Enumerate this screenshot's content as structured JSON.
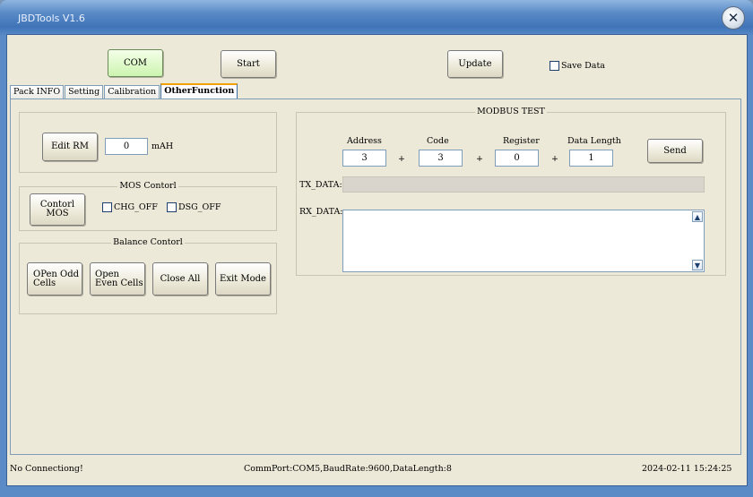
{
  "window": {
    "title": "JBDTools V1.6"
  },
  "toolbar": {
    "com_label": "COM",
    "start_label": "Start",
    "update_label": "Update",
    "save_data_label": "Save Data"
  },
  "tabs": [
    "Pack INFO",
    "Setting",
    "Calibration",
    "OtherFunction"
  ],
  "rm": {
    "button_label": "Edit RM",
    "value": "0",
    "unit": "mAH"
  },
  "mos": {
    "title": "MOS Contorl",
    "button_label": "Contorl MOS",
    "chg_label": "CHG_OFF",
    "dsg_label": "DSG_OFF"
  },
  "balance": {
    "title": "Balance  Contorl",
    "open_odd_label": "OPen Odd Cells",
    "open_even_label": "Open Even Cells",
    "close_all_label": "Close All",
    "exit_mode_label": "Exit Mode"
  },
  "modbus": {
    "title": "MODBUS TEST",
    "address_label": "Address",
    "code_label": "Code",
    "register_label": "Register",
    "length_label": "Data Length",
    "address_value": "3",
    "code_value": "3",
    "register_value": "0",
    "length_value": "1",
    "plus": "+",
    "send_label": "Send",
    "tx_label": "TX_DATA:",
    "rx_label": "RX_DATA:"
  },
  "status": {
    "connection": "No Connectiong!",
    "port_info": "CommPort:COM5,BaudRate:9600,DataLength:8",
    "datetime": "2024-02-11  15:24:25"
  },
  "colors": {
    "title_bar": "#3f74b8",
    "client_bg": "#ece9d8",
    "active_button": "#ccf4b0"
  }
}
